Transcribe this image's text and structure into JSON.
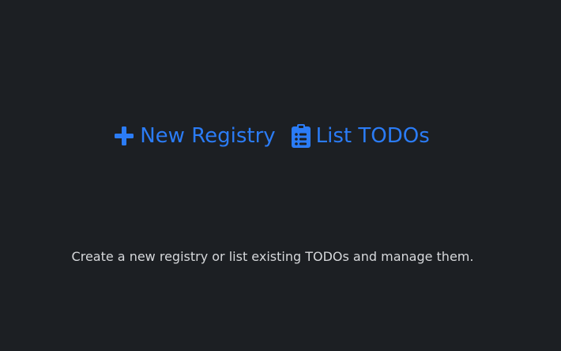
{
  "actions": {
    "new_registry": {
      "label": "New Registry",
      "icon": "plus-icon"
    },
    "list_todos": {
      "label": "List TODOs",
      "icon": "clipboard-list-icon"
    }
  },
  "description": "Create a new registry or list existing TODOs and manage them.",
  "colors": {
    "background": "#1c1f23",
    "accent": "#2b7cf6",
    "text": "#d6d8db"
  }
}
